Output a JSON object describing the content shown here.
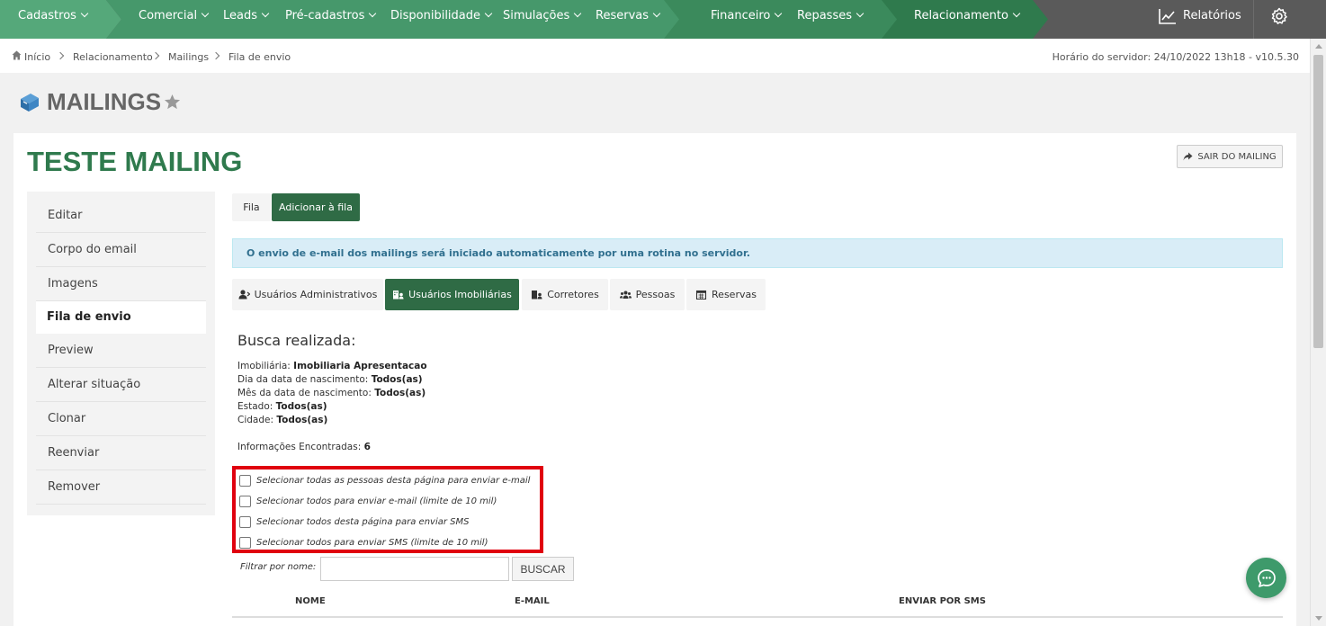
{
  "nav": {
    "items": [
      {
        "label": "Cadastros"
      },
      {
        "label": "Comercial"
      },
      {
        "label": "Leads"
      },
      {
        "label": "Pré-cadastros"
      },
      {
        "label": "Disponibilidade"
      },
      {
        "label": "Simulações"
      },
      {
        "label": "Reservas"
      },
      {
        "label": "Financeiro"
      },
      {
        "label": "Repasses"
      },
      {
        "label": "Relacionamento"
      }
    ],
    "reports_label": "Relatórios",
    "reports_icon": "line-chart-icon",
    "settings_icon": "gear-icon"
  },
  "breadcrumb": {
    "items": [
      "Início",
      "Relacionamento",
      "Mailings",
      "Fila de envio"
    ],
    "server_time": "Horário do servidor: 24/10/2022 13h18 - v10.5.30"
  },
  "page": {
    "title": "MAILINGS",
    "icon": "mailbox-icon",
    "favorite_icon": "star-icon"
  },
  "mailing": {
    "title": "TESTE MAILING",
    "exit_button": "SAIR DO MAILING"
  },
  "sidebar": {
    "items": [
      {
        "label": "Editar"
      },
      {
        "label": "Corpo do email"
      },
      {
        "label": "Imagens"
      },
      {
        "label": "Fila de envio",
        "active": true
      },
      {
        "label": "Preview"
      },
      {
        "label": "Alterar situação"
      },
      {
        "label": "Clonar"
      },
      {
        "label": "Reenviar"
      },
      {
        "label": "Remover"
      }
    ]
  },
  "tabs": {
    "fila": "Fila",
    "adicionar": "Adicionar à fila"
  },
  "alert": "O envio de e-mail dos mailings será iniciado automaticamente por uma rotina no servidor.",
  "subtabs": [
    {
      "label": "Usuários Administrativos",
      "icon": "user-admin-icon"
    },
    {
      "label": "Usuários Imobiliárias",
      "icon": "building-user-icon",
      "active": true
    },
    {
      "label": "Corretores",
      "icon": "broker-icon"
    },
    {
      "label": "Pessoas",
      "icon": "people-icon"
    },
    {
      "label": "Reservas",
      "icon": "calendar-icon"
    }
  ],
  "search": {
    "title": "Busca realizada:",
    "filters": [
      {
        "label": "Imobiliária:",
        "value": "Imobiliaria Apresentacao"
      },
      {
        "label": "Dia da data de nascimento:",
        "value": "Todos(as)"
      },
      {
        "label": "Mês da data de nascimento:",
        "value": "Todos(as)"
      },
      {
        "label": "Estado:",
        "value": "Todos(as)"
      },
      {
        "label": "Cidade:",
        "value": "Todos(as)"
      }
    ],
    "found_label": "Informações Encontradas:",
    "found_value": "6"
  },
  "selection": {
    "options": [
      {
        "label": "Selecionar todas as pessoas desta página para enviar e-mail",
        "checked": false
      },
      {
        "label": "Selecionar todos para enviar e-mail (limite de 10 mil)",
        "checked": false
      },
      {
        "label": "Selecionar todos desta página para enviar SMS",
        "checked": false
      },
      {
        "label": "Selecionar todos para enviar SMS (limite de 10 mil)",
        "checked": false
      }
    ]
  },
  "filter": {
    "label": "Filtrar por nome:",
    "value": "",
    "button": "BUSCAR"
  },
  "table": {
    "columns": [
      "NOME",
      "E-MAIL",
      "ENVIAR POR SMS"
    ]
  },
  "colors": {
    "primary_green": "#2f7a4d",
    "nav_gray": "#5a5a5a",
    "highlight_red": "#e0000f",
    "alert_bg": "#d9edf7"
  }
}
